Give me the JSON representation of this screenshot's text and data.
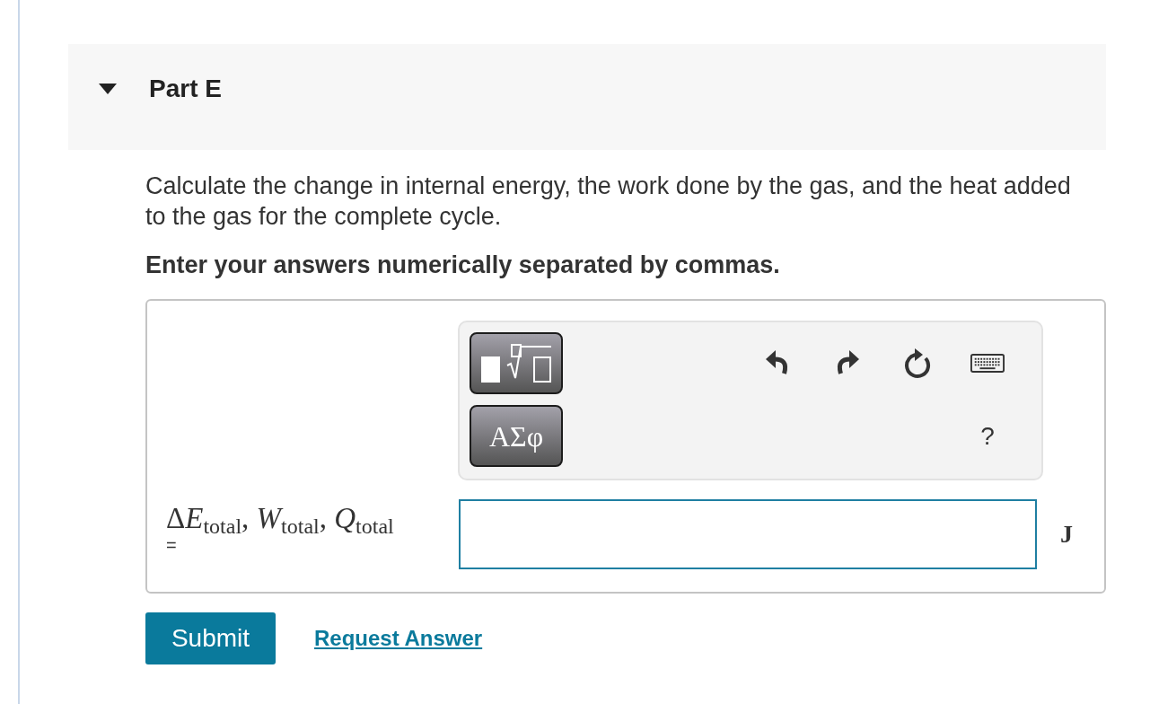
{
  "part": {
    "title": "Part E",
    "expanded": true
  },
  "question": {
    "prompt": "Calculate the change in internal energy, the work done by the gas, and the heat added to the gas for the complete cycle.",
    "instruction": "Enter your answers numerically separated by commas."
  },
  "answer": {
    "toolbar": {
      "tools": [
        {
          "kind": "templates"
        },
        {
          "kind": "symbols",
          "label": "ΑΣφ"
        }
      ],
      "actions": [
        {
          "kind": "undo"
        },
        {
          "kind": "redo"
        },
        {
          "kind": "reset"
        },
        {
          "kind": "keyboard"
        }
      ],
      "help": "?"
    },
    "label": [
      {
        "prefix": "Δ",
        "symbol": "E",
        "subscript": "total",
        "separator": ","
      },
      {
        "symbol": "W",
        "subscript": "total",
        "separator": ","
      },
      {
        "symbol": "Q",
        "subscript": "total"
      }
    ],
    "equals": "=",
    "unit": "J"
  },
  "buttons": [
    {
      "kind": "primary",
      "label": "Submit"
    },
    {
      "kind": "link",
      "label": "Request Answer"
    }
  ]
}
